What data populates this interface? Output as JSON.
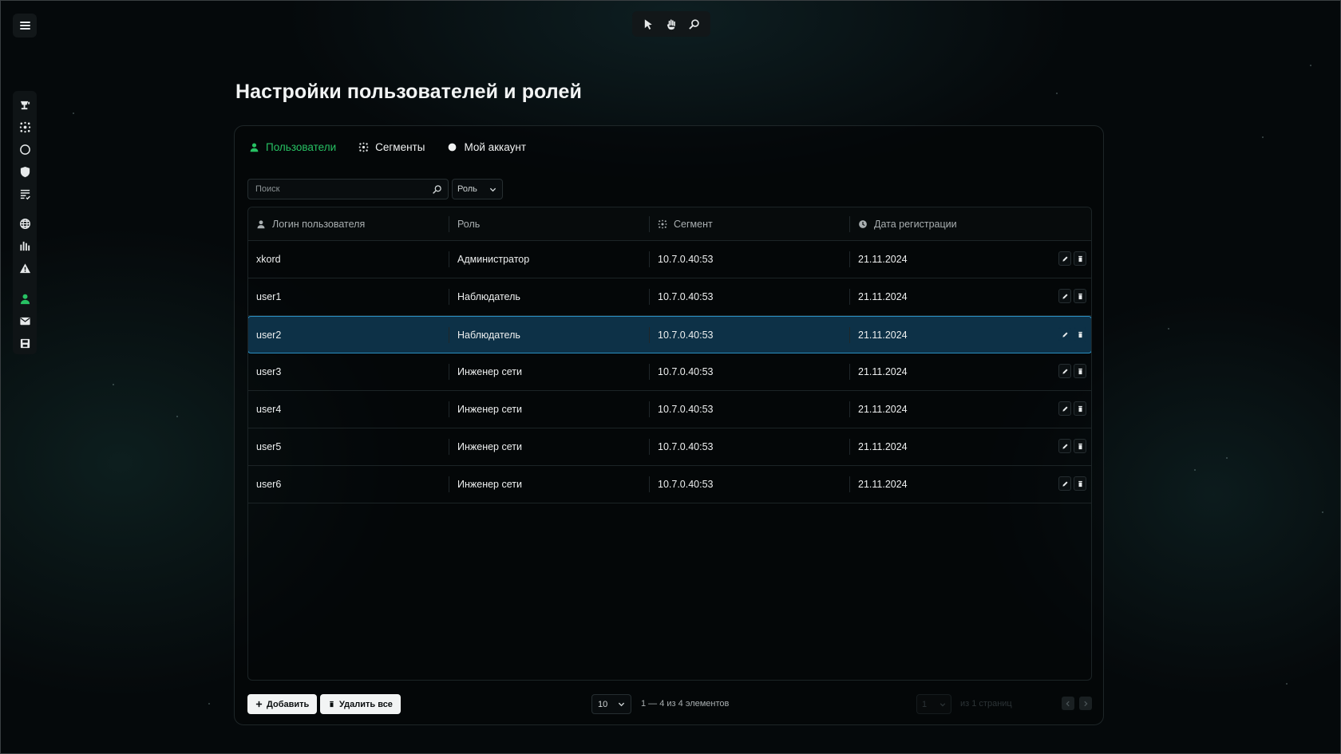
{
  "page": {
    "title": "Настройки пользователей и ролей"
  },
  "toolbar": {
    "tools": [
      "cursor-icon",
      "hand-icon",
      "zoom-icon"
    ]
  },
  "sidebar": {
    "items": [
      {
        "icon": "camera-icon"
      },
      {
        "icon": "network-icon"
      },
      {
        "icon": "circle-icon"
      },
      {
        "icon": "shield-icon"
      },
      {
        "icon": "checklist-icon"
      },
      {
        "icon": "globe-icon"
      },
      {
        "icon": "bar-chart-icon"
      },
      {
        "icon": "warning-icon"
      },
      {
        "icon": "user-icon",
        "active": true
      },
      {
        "icon": "mail-icon"
      },
      {
        "icon": "save-icon"
      }
    ]
  },
  "tabs": [
    {
      "label": "Пользователи",
      "icon": "user-icon",
      "active": true
    },
    {
      "label": "Сегменты",
      "icon": "network-icon",
      "active": false
    },
    {
      "label": "Мой аккаунт",
      "icon": "circle-icon",
      "active": false
    }
  ],
  "filters": {
    "search_placeholder": "Поиск",
    "role_label": "Роль"
  },
  "table": {
    "columns": [
      "Логин пользователя",
      "Роль",
      "Сегмент",
      "Дата регистрации"
    ],
    "rows": [
      {
        "login": "xkord",
        "role": "Администратор",
        "segment": "10.7.0.40:53",
        "date": "21.11.2024"
      },
      {
        "login": "user1",
        "role": "Наблюдатель",
        "segment": "10.7.0.40:53",
        "date": "21.11.2024"
      },
      {
        "login": "user2",
        "role": "Наблюдатель",
        "segment": "10.7.0.40:53",
        "date": "21.11.2024",
        "selected": true
      },
      {
        "login": "user3",
        "role": "Инженер сети",
        "segment": "10.7.0.40:53",
        "date": "21.11.2024"
      },
      {
        "login": "user4",
        "role": "Инженер сети",
        "segment": "10.7.0.40:53",
        "date": "21.11.2024"
      },
      {
        "login": "user5",
        "role": "Инженер сети",
        "segment": "10.7.0.40:53",
        "date": "21.11.2024"
      },
      {
        "login": "user6",
        "role": "Инженер сети",
        "segment": "10.7.0.40:53",
        "date": "21.11.2024"
      }
    ]
  },
  "footer": {
    "add_label": "Добавить",
    "delete_all_label": "Удалить все",
    "per_page": "10",
    "range_text": "1 — 4 из 4 элементов",
    "page_current": "1",
    "pages_text": "из 1 страниц"
  },
  "colors": {
    "accent_green": "#27c163",
    "selected_row_bg": "#0d3147",
    "selected_row_border": "#2a8ec1",
    "background": "#05090b"
  }
}
